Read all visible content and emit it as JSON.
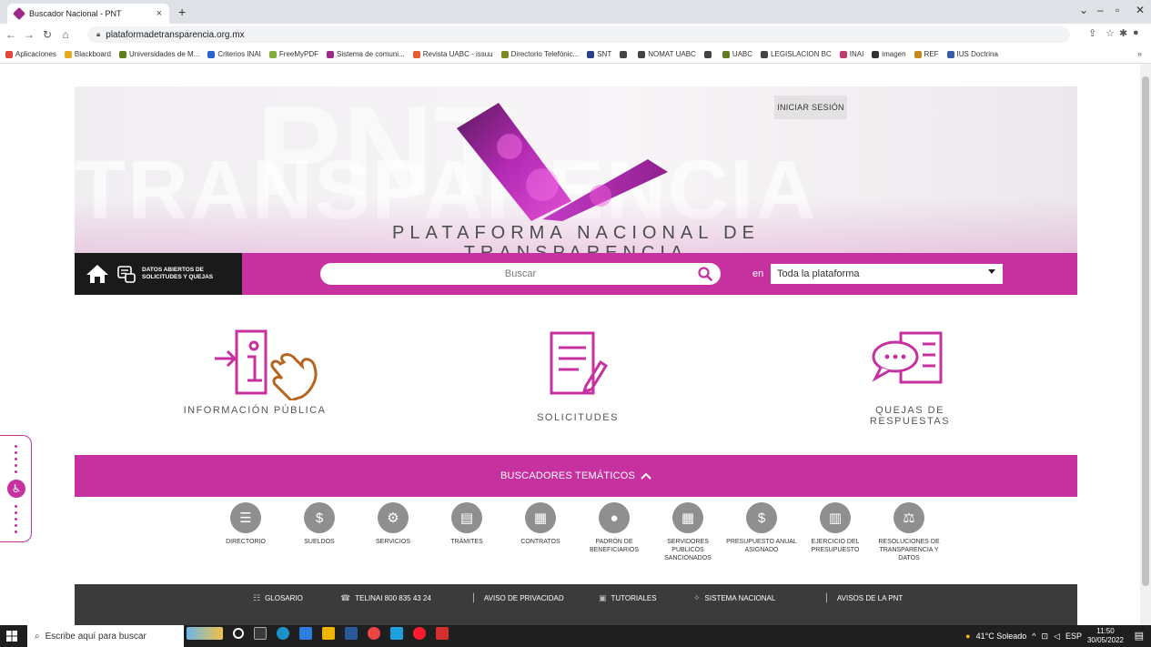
{
  "browser": {
    "tab_title": "Buscador Nacional - PNT",
    "tab_close": "×",
    "new_tab": "+",
    "url": "plataformadetransparencia.org.mx",
    "bookmarks": [
      {
        "label": "Aplicaciones",
        "color": "#e6453a"
      },
      {
        "label": "Blackboard",
        "color": "#e8a91d"
      },
      {
        "label": "Universidades de M...",
        "color": "#5f7d1a"
      },
      {
        "label": "Criterios INAI",
        "color": "#2a62c9"
      },
      {
        "label": "FreeMyPDF",
        "color": "#7fae3b"
      },
      {
        "label": "Sistema de comuni...",
        "color": "#9d2a89"
      },
      {
        "label": "Revista UABC - issuu",
        "color": "#e65c2e"
      },
      {
        "label": "Directorio Telefónic...",
        "color": "#7c8a1f"
      },
      {
        "label": "SNT",
        "color": "#2b3f8a"
      },
      {
        "label": "",
        "color": "#444444"
      },
      {
        "label": "NOMAT UABC",
        "color": "#444444"
      },
      {
        "label": "",
        "color": "#444444"
      },
      {
        "label": "UABC",
        "color": "#5f7d1a"
      },
      {
        "label": "LEGISLACION BC",
        "color": "#444444"
      },
      {
        "label": "INAI",
        "color": "#c23b6e"
      },
      {
        "label": "imagen",
        "color": "#333333"
      },
      {
        "label": "REF",
        "color": "#c68a1c"
      },
      {
        "label": "IUS Doctrina",
        "color": "#3a5ba8"
      }
    ],
    "bookmarks_more": "»"
  },
  "hero": {
    "login_label": "INICIAR SESIÓN",
    "title_line1": "PLATAFORMA NACIONAL DE",
    "title_line2": "TRANSPARENCIA",
    "bg_word": "TRANSPARENCIA",
    "bg_letters": "PNT"
  },
  "search": {
    "datos_label_1": "DATOS ABIERTOS DE",
    "datos_label_2": "SOLICITUDES Y QUEJAS",
    "placeholder": "Buscar",
    "en_label": "en",
    "scope_value": "Toda la plataforma"
  },
  "main_options": [
    {
      "label": "INFORMACIÓN PÚBLICA"
    },
    {
      "label": "SOLICITUDES"
    },
    {
      "label": "QUEJAS DE RESPUESTAS"
    }
  ],
  "tematicos": {
    "label": "BUSCADORES TEMÁTICOS",
    "chevron": "^"
  },
  "topics": [
    {
      "label": "DIRECTORIO"
    },
    {
      "label": "SUELDOS"
    },
    {
      "label": "SERVICIOS"
    },
    {
      "label": "TRÁMITES"
    },
    {
      "label": "CONTRATOS"
    },
    {
      "label": "PADRÓN DE BENEFICIARIOS"
    },
    {
      "label": "SERVIDORES PÚBLICOS SANCIONADOS"
    },
    {
      "label": "PRESUPUESTO ANUAL ASIGNADO"
    },
    {
      "label": "EJERCICIO DEL PRESUPUESTO"
    },
    {
      "label": "RESOLUCIONES DE TRANSPARENCIA Y DATOS"
    }
  ],
  "footer": {
    "links": [
      {
        "label": "GLOSARIO"
      },
      {
        "label": "TELINAI 800 835 43 24"
      },
      {
        "label": "AVISO DE PRIVACIDAD"
      },
      {
        "label": "TUTORIALES"
      },
      {
        "label": "SISTEMA NACIONAL"
      },
      {
        "label": "AVISOS DE LA PNT"
      }
    ]
  },
  "taskbar": {
    "search_placeholder": "Escribe aquí para buscar",
    "weather": "41°C  Soleado",
    "language": "ESP",
    "time": "11:50",
    "date": "30/05/2022"
  },
  "colors": {
    "brand_magenta": "#c6309f",
    "dark_footer": "#3b3b3b",
    "icon_gray": "#8f8f8f"
  }
}
